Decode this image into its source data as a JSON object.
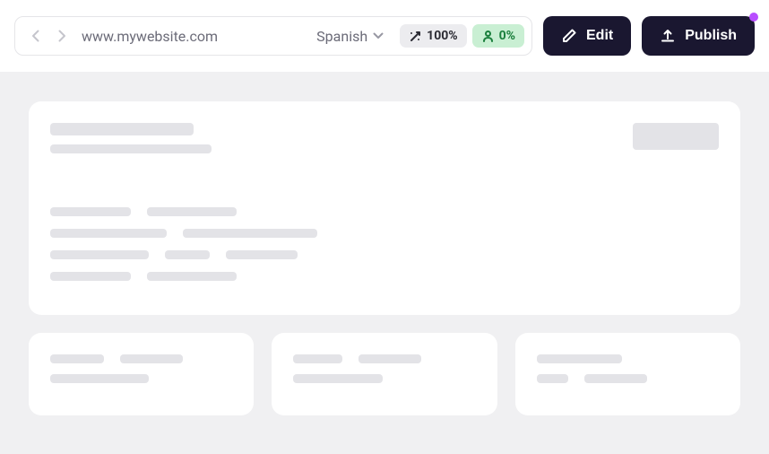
{
  "topbar": {
    "url": "www.mywebsite.com",
    "language": "Spanish",
    "translation_badge": "100%",
    "review_badge": "0%",
    "edit_label": "Edit",
    "publish_label": "Publish"
  }
}
